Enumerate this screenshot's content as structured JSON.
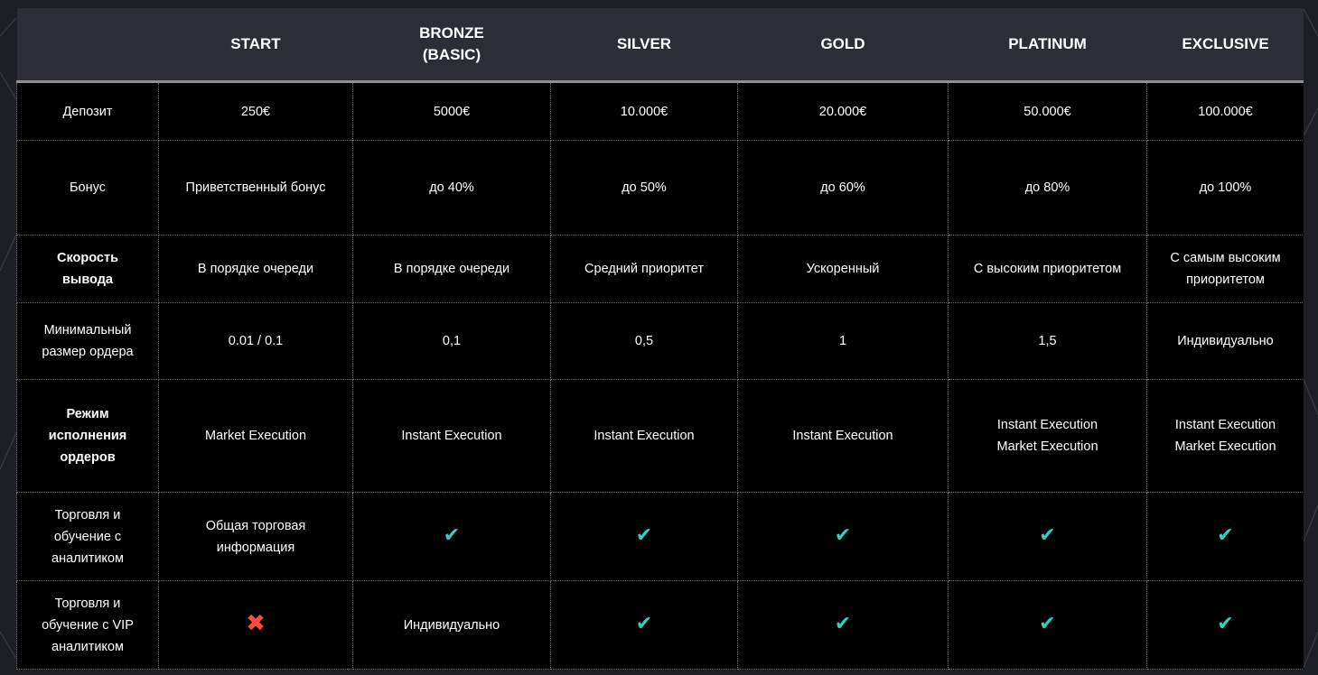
{
  "header": {
    "plans": [
      "START",
      "BRONZE\n(BASIC)",
      "SILVER",
      "GOLD",
      "PLATINUM",
      "EXCLUSIVE"
    ]
  },
  "rows": [
    {
      "label": [
        "Депозит"
      ],
      "bold": false,
      "cells": [
        [
          "250€"
        ],
        [
          "5000€"
        ],
        [
          "10.000€"
        ],
        [
          "20.000€"
        ],
        [
          "50.000€"
        ],
        [
          "100.000€"
        ]
      ]
    },
    {
      "label": [
        "Бонус"
      ],
      "bold": false,
      "cells": [
        [
          "Приветственный бонус"
        ],
        [
          "до 40%"
        ],
        [
          "до 50%"
        ],
        [
          "до 60%"
        ],
        [
          "до 80%"
        ],
        [
          "до 100%"
        ]
      ]
    },
    {
      "label": [
        "Скорость",
        "вывода"
      ],
      "bold": true,
      "cells": [
        [
          "В порядке очереди"
        ],
        [
          "В порядке очереди"
        ],
        [
          "Средний приоритет"
        ],
        [
          "Ускоренный"
        ],
        [
          "С высоким приоритетом"
        ],
        [
          "С самым высоким",
          "приоритетом"
        ]
      ]
    },
    {
      "label": [
        "Минимальный",
        "размер ордера"
      ],
      "bold": false,
      "cells": [
        [
          "0.01 / 0.1"
        ],
        [
          "0,1"
        ],
        [
          "0,5"
        ],
        [
          "1"
        ],
        [
          "1,5"
        ],
        [
          "Индивидуально"
        ]
      ]
    },
    {
      "label": [
        "Режим",
        "исполнения",
        "ордеров"
      ],
      "bold": true,
      "cells": [
        [
          "Market Execution"
        ],
        [
          "Instant Execution"
        ],
        [
          "Instant Execution"
        ],
        [
          "Instant Execution"
        ],
        [
          "Instant Execution",
          "Market Execution"
        ],
        [
          "Instant Execution",
          "Market Execution"
        ]
      ]
    },
    {
      "label": [
        "Торговля и",
        "обучение с",
        "аналитиком"
      ],
      "bold": false,
      "cells": [
        [
          "Общая торговая",
          "информация"
        ],
        [
          "check"
        ],
        [
          "check"
        ],
        [
          "check"
        ],
        [
          "check"
        ],
        [
          "check"
        ]
      ]
    },
    {
      "label": [
        "Торговля и",
        "обучение с VIP",
        "аналитиком"
      ],
      "bold": false,
      "cells": [
        [
          "cross"
        ],
        [
          "Индивидуально"
        ],
        [
          "check"
        ],
        [
          "check"
        ],
        [
          "check"
        ],
        [
          "check"
        ]
      ]
    }
  ],
  "icons": {
    "check": "check-icon",
    "cross": "cross-icon"
  },
  "colors": {
    "check": "#2fd0c0",
    "cross": "#ff4a3d",
    "header_bg": "#2c2e36",
    "cell_bg": "#000000",
    "page_bg": "#1e1f24"
  }
}
